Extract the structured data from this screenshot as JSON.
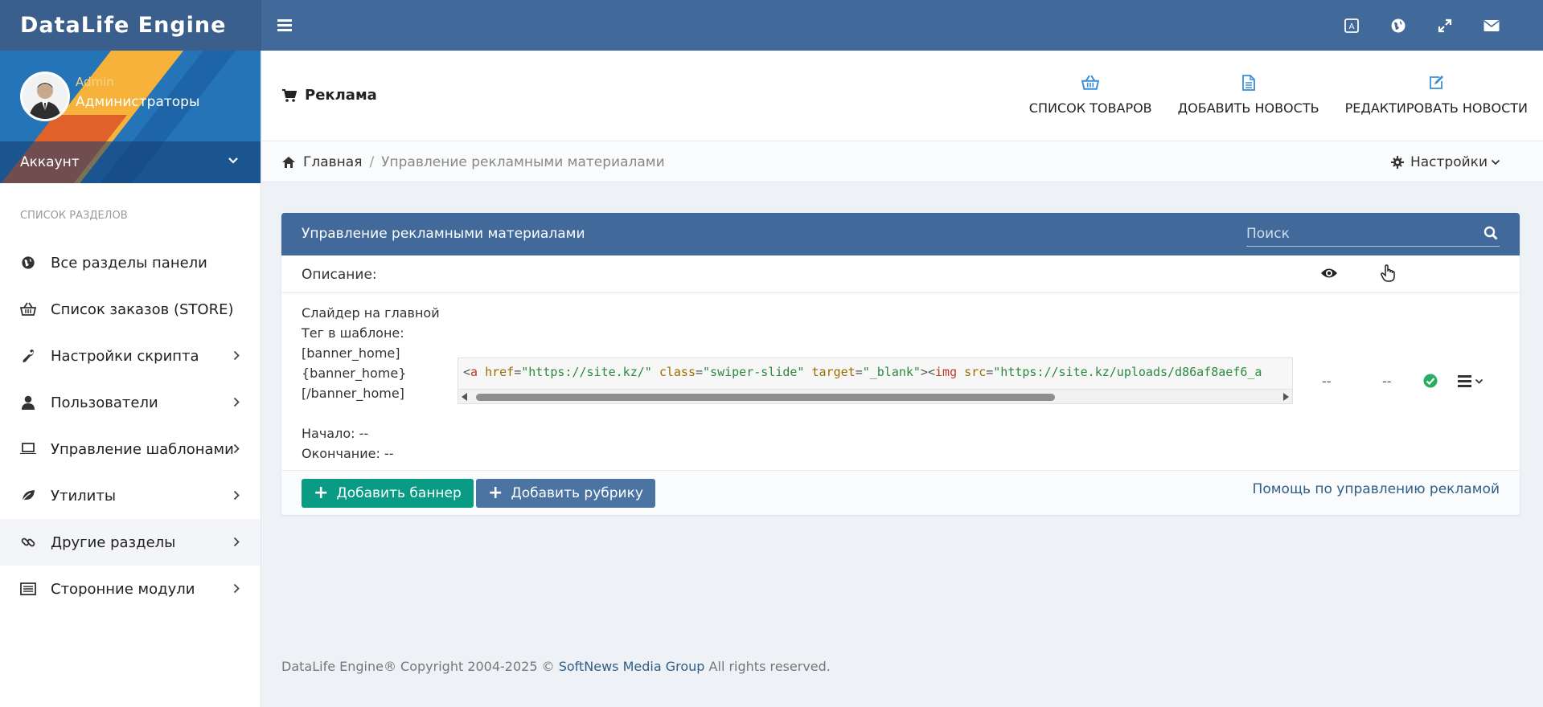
{
  "app": {
    "brand": "DataLife Engine"
  },
  "topbar": {
    "icons": [
      {
        "name": "translate-icon"
      },
      {
        "name": "globe-icon"
      },
      {
        "name": "fullscreen-icon"
      },
      {
        "name": "mail-icon"
      }
    ]
  },
  "sidebar": {
    "user": {
      "name": "Admin",
      "group": "Администраторы"
    },
    "account_label": "Аккаунт",
    "caption": "Список разделов",
    "items": [
      {
        "label": "Все разделы панели",
        "icon": "globe-icon",
        "has_arrow": false
      },
      {
        "label": "Список заказов (STORE)",
        "icon": "basket-icon",
        "has_arrow": false
      },
      {
        "label": "Настройки скрипта",
        "icon": "wrench-icon",
        "has_arrow": true
      },
      {
        "label": "Пользователи",
        "icon": "user-icon",
        "has_arrow": true
      },
      {
        "label": "Управление шаблонами",
        "icon": "laptop-icon",
        "has_arrow": true
      },
      {
        "label": "Утилиты",
        "icon": "leaf-icon",
        "has_arrow": true
      },
      {
        "label": "Другие разделы",
        "icon": "link-icon",
        "has_arrow": true,
        "active": true
      },
      {
        "label": "Сторонние модули",
        "icon": "list-icon",
        "has_arrow": true
      }
    ]
  },
  "header": {
    "title": "Реклама",
    "actions": [
      {
        "label": "Список товаров",
        "icon": "basket-icon"
      },
      {
        "label": "Добавить новость",
        "icon": "file-icon"
      },
      {
        "label": "Редактировать новости",
        "icon": "edit-icon"
      }
    ]
  },
  "breadcrumb": {
    "home": "Главная",
    "separator": "/",
    "current": "Управление рекламными материалами",
    "settings_label": "Настройки"
  },
  "panel": {
    "title": "Управление рекламными материалами",
    "search_placeholder": "Поиск",
    "description_label": "Описание:",
    "banner": {
      "name": "Слайдер на главной",
      "tag_label": "Тег в шаблоне:",
      "tag_lines": [
        "[banner_home]",
        "{banner_home}",
        "[/banner_home]"
      ],
      "start": "Начало: --",
      "end": "Окончание: --",
      "code_tokens": [
        {
          "t": "punct",
          "v": "<"
        },
        {
          "t": "tag",
          "v": "a"
        },
        {
          "t": "punct",
          "v": " "
        },
        {
          "t": "attr",
          "v": "href"
        },
        {
          "t": "punct",
          "v": "="
        },
        {
          "t": "str",
          "v": "\"https://site.kz/\""
        },
        {
          "t": "punct",
          "v": " "
        },
        {
          "t": "attr",
          "v": "class"
        },
        {
          "t": "punct",
          "v": "="
        },
        {
          "t": "str",
          "v": "\"swiper-slide\""
        },
        {
          "t": "punct",
          "v": " "
        },
        {
          "t": "attr",
          "v": "target"
        },
        {
          "t": "punct",
          "v": "="
        },
        {
          "t": "str",
          "v": "\"_blank\""
        },
        {
          "t": "punct",
          "v": "><"
        },
        {
          "t": "tag",
          "v": "img"
        },
        {
          "t": "punct",
          "v": " "
        },
        {
          "t": "attr",
          "v": "src"
        },
        {
          "t": "punct",
          "v": "="
        },
        {
          "t": "str",
          "v": "\"https://site.kz/uploads/d86af8aef6_a"
        }
      ],
      "views": "--",
      "clicks": "--",
      "status": "active"
    },
    "buttons": {
      "add_banner": "Добавить баннер",
      "add_category": "Добавить рубрику"
    },
    "help_link": "Помощь по управлению рекламой"
  },
  "footer": {
    "prefix": "DataLife Engine® Copyright 2004-2025 ©",
    "company": "SoftNews Media Group",
    "suffix": "All rights reserved."
  },
  "colors": {
    "topbar": "#41699a",
    "brand_bg": "#3b5f8d",
    "green_button": "#0a9b85",
    "blue_button": "#4b74a2",
    "status_ok": "#27ae60",
    "link": "#2f5e86",
    "accent_icon": "#3b8fd6"
  }
}
